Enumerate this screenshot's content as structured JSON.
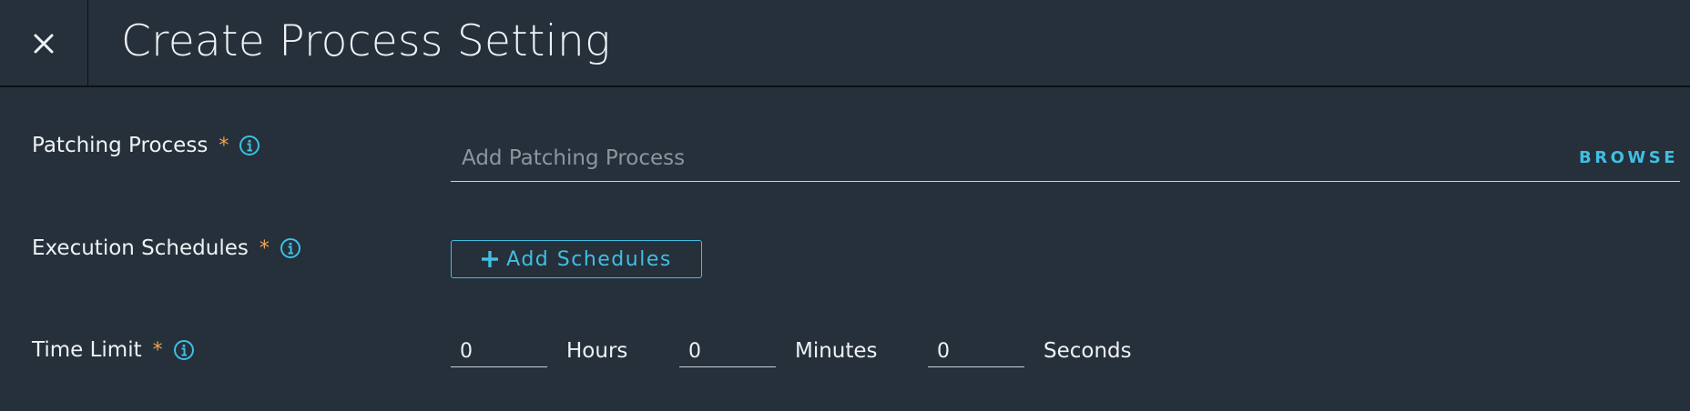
{
  "header": {
    "title": "Create Process Setting",
    "close_icon": "close-icon"
  },
  "form": {
    "patching_process": {
      "label": "Patching Process",
      "required_marker": "*",
      "info_icon": "info-icon",
      "placeholder": "Add Patching Process",
      "value": "",
      "browse_label": "BROWSE"
    },
    "execution_schedules": {
      "label": "Execution Schedules",
      "required_marker": "*",
      "info_icon": "info-icon",
      "button_label": "Add Schedules",
      "button_icon": "plus-icon"
    },
    "time_limit": {
      "label": "Time Limit",
      "required_marker": "*",
      "info_icon": "info-icon",
      "hours": {
        "value": "0",
        "unit": "Hours"
      },
      "minutes": {
        "value": "0",
        "unit": "Minutes"
      },
      "seconds": {
        "value": "0",
        "unit": "Seconds"
      }
    }
  },
  "colors": {
    "background": "#25303b",
    "accent": "#3fbfe3",
    "required": "#f0a44b",
    "text": "#eef2f5",
    "placeholder": "#8c969f"
  }
}
